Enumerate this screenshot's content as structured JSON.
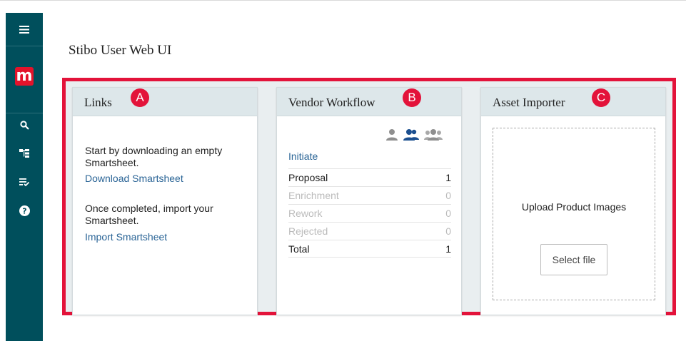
{
  "app": {
    "title": "Stibo User Web UI"
  },
  "sidebar": {
    "logo_letter": "m",
    "icons": [
      "menu-icon",
      "search-icon",
      "hierarchy-icon",
      "task-list-icon",
      "help-icon"
    ],
    "brand_color": "#004f5c",
    "logo_color": "#e3132b"
  },
  "highlight_color": "#e3133a",
  "links_panel": {
    "title": "Links",
    "marker": "A",
    "intro_text": "Start by downloading an empty Smartsheet.",
    "download_link": "Download Smartsheet",
    "import_text": "Once completed, import your Smartsheet.",
    "import_link": "Import Smartsheet"
  },
  "workflow_panel": {
    "title": "Vendor Workflow",
    "marker": "B",
    "icons": [
      "single-user-icon",
      "assigned-users-icon",
      "group-users-icon"
    ],
    "initiate_link": "Initiate",
    "rows": [
      {
        "label": "Proposal",
        "count": "1"
      },
      {
        "label": "Enrichment",
        "count": "0"
      },
      {
        "label": "Rework",
        "count": "0"
      },
      {
        "label": "Rejected",
        "count": "0"
      },
      {
        "label": "Total",
        "count": "1"
      }
    ]
  },
  "asset_panel": {
    "title": "Asset Importer",
    "marker": "C",
    "upload_label": "Upload Product Images",
    "select_button": "Select file"
  }
}
